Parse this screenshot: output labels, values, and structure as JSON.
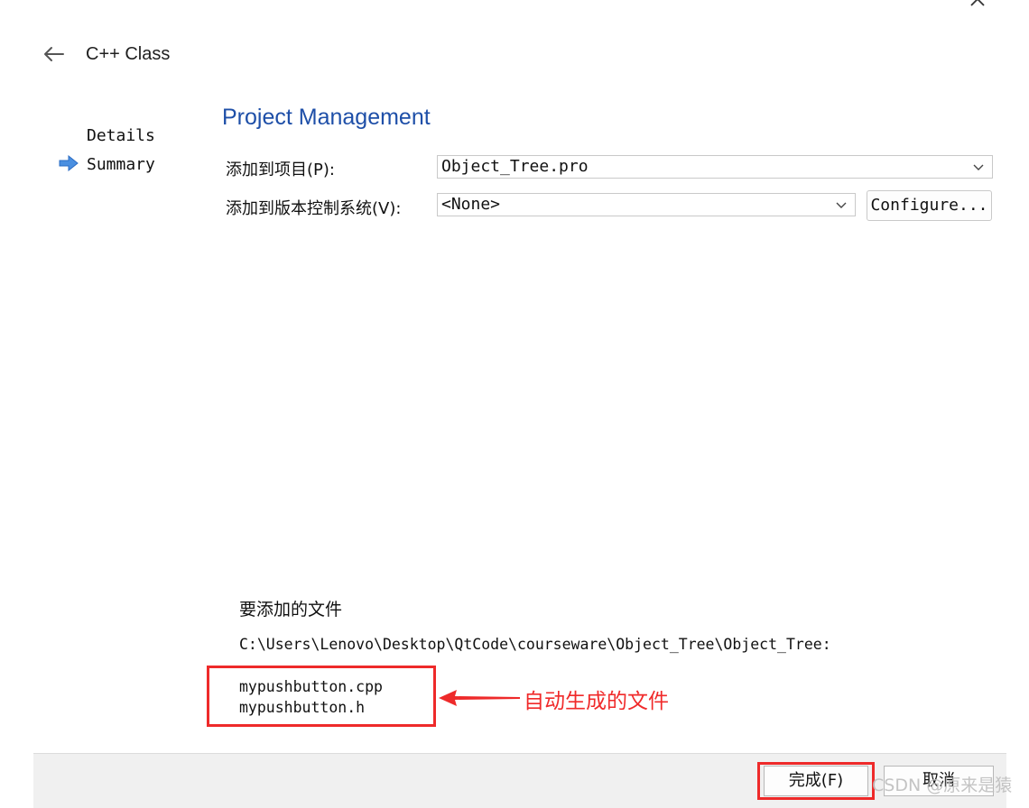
{
  "window": {
    "title": "C++ Class"
  },
  "steps": [
    {
      "label": "Details"
    },
    {
      "label": "Summary"
    }
  ],
  "section": {
    "title": "Project Management"
  },
  "fields": {
    "add_to_project_label": "添加到项目(P):",
    "add_to_project_value": "Object_Tree.pro",
    "add_to_vcs_label": "添加到版本控制系统(V):",
    "add_to_vcs_value": "<None>",
    "configure_label": "Configure..."
  },
  "files": {
    "heading": "要添加的文件",
    "path": "C:\\Users\\Lenovo\\Desktop\\QtCode\\courseware\\Object_Tree\\Object_Tree:",
    "list": [
      "mypushbutton.cpp",
      "mypushbutton.h"
    ]
  },
  "annotation": {
    "text": "自动生成的文件"
  },
  "footer": {
    "finish_label": "完成(F)",
    "cancel_label": "取消"
  },
  "watermark": {
    "text": "CSDN @原来是猿"
  },
  "icons": {
    "close": "close-icon",
    "back": "back-arrow-icon",
    "current_step": "arrow-right-icon",
    "dropdown": "chevron-down-icon"
  },
  "colors": {
    "section_title": "#1e4fa8",
    "step_arrow": "#4a8fe0",
    "annotation": "#ee2a2a",
    "footer_bg": "#f0f0f0"
  }
}
